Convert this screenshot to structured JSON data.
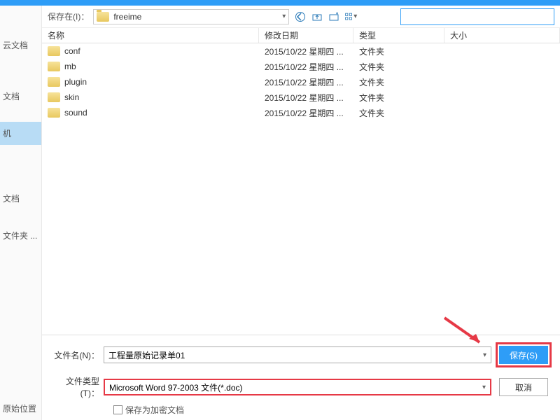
{
  "sidebar": {
    "items": [
      {
        "label": "云文档"
      },
      {
        "label": "文档"
      },
      {
        "label": "机"
      },
      {
        "label": "文档"
      },
      {
        "label": "文件夹 ..."
      }
    ],
    "bottom_label": "原始位置"
  },
  "toolbar": {
    "save_in_label": "保存在(I)：",
    "current_folder": "freeime",
    "search_placeholder": ""
  },
  "columns": {
    "name": "名称",
    "date": "修改日期",
    "type": "类型",
    "size": "大小"
  },
  "files": [
    {
      "name": "conf",
      "date": "2015/10/22 星期四 ...",
      "type": "文件夹",
      "size": ""
    },
    {
      "name": "mb",
      "date": "2015/10/22 星期四 ...",
      "type": "文件夹",
      "size": ""
    },
    {
      "name": "plugin",
      "date": "2015/10/22 星期四 ...",
      "type": "文件夹",
      "size": ""
    },
    {
      "name": "skin",
      "date": "2015/10/22 星期四 ...",
      "type": "文件夹",
      "size": ""
    },
    {
      "name": "sound",
      "date": "2015/10/22 星期四 ...",
      "type": "文件夹",
      "size": ""
    }
  ],
  "bottom": {
    "filename_label": "文件名(N)：",
    "filename_value": "工程量原始记录单01",
    "filetype_label": "文件类型(T)：",
    "filetype_value": "Microsoft Word 97-2003 文件(*.doc)",
    "save_button": "保存(S)",
    "cancel_button": "取消",
    "checkbox_label_partial": "保存为加密文档"
  }
}
